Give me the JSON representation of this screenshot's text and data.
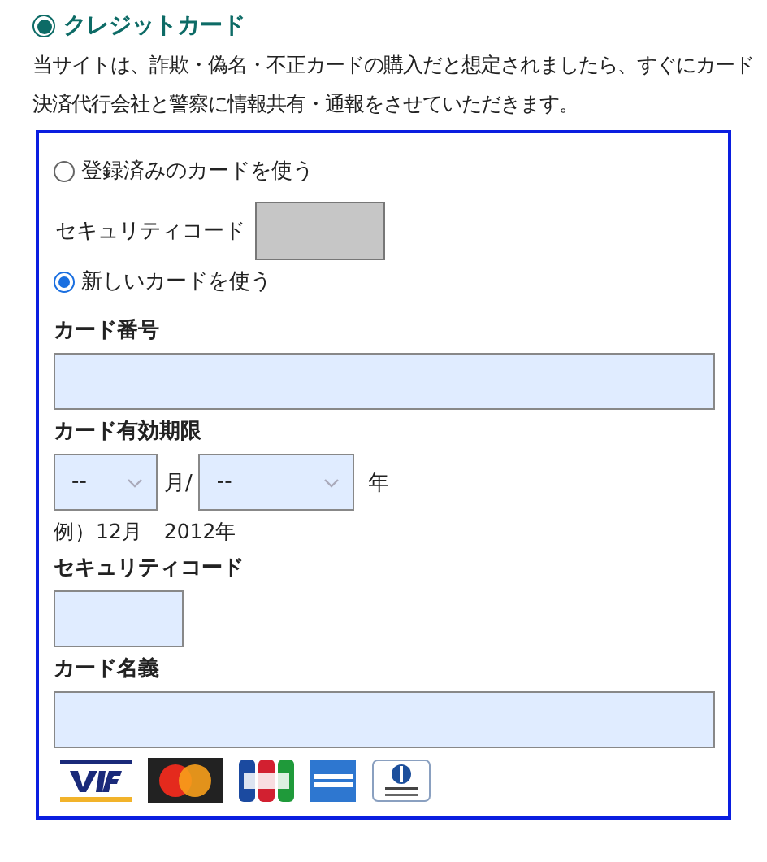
{
  "payment_option": {
    "label": "クレジットカード",
    "selected": true
  },
  "notice": "当サイトは、詐欺・偽名・不正カードの購入だと想定されましたら、すぐにカード決済代行会社と警察に情報共有・通報をさせていただきます。",
  "saved_card": {
    "label": "登録済みのカードを使う",
    "selected": false,
    "security_code_label": "セキュリティコード",
    "security_code_disabled": true
  },
  "new_card": {
    "label": "新しいカードを使う",
    "selected": true
  },
  "card_number": {
    "label": "カード番号"
  },
  "expiry": {
    "label": "カード有効期限",
    "month": {
      "value": "--",
      "unit": "月/"
    },
    "year": {
      "value": "--",
      "unit": "年"
    },
    "example": "例）12月　2012年"
  },
  "security_code": {
    "label": "セキュリティコード"
  },
  "card_name": {
    "label": "カード名義"
  },
  "card_brands": [
    {
      "kind": "visa"
    },
    {
      "kind": "mastercard"
    },
    {
      "kind": "jcb"
    },
    {
      "kind": "amex"
    },
    {
      "kind": "diners"
    }
  ]
}
